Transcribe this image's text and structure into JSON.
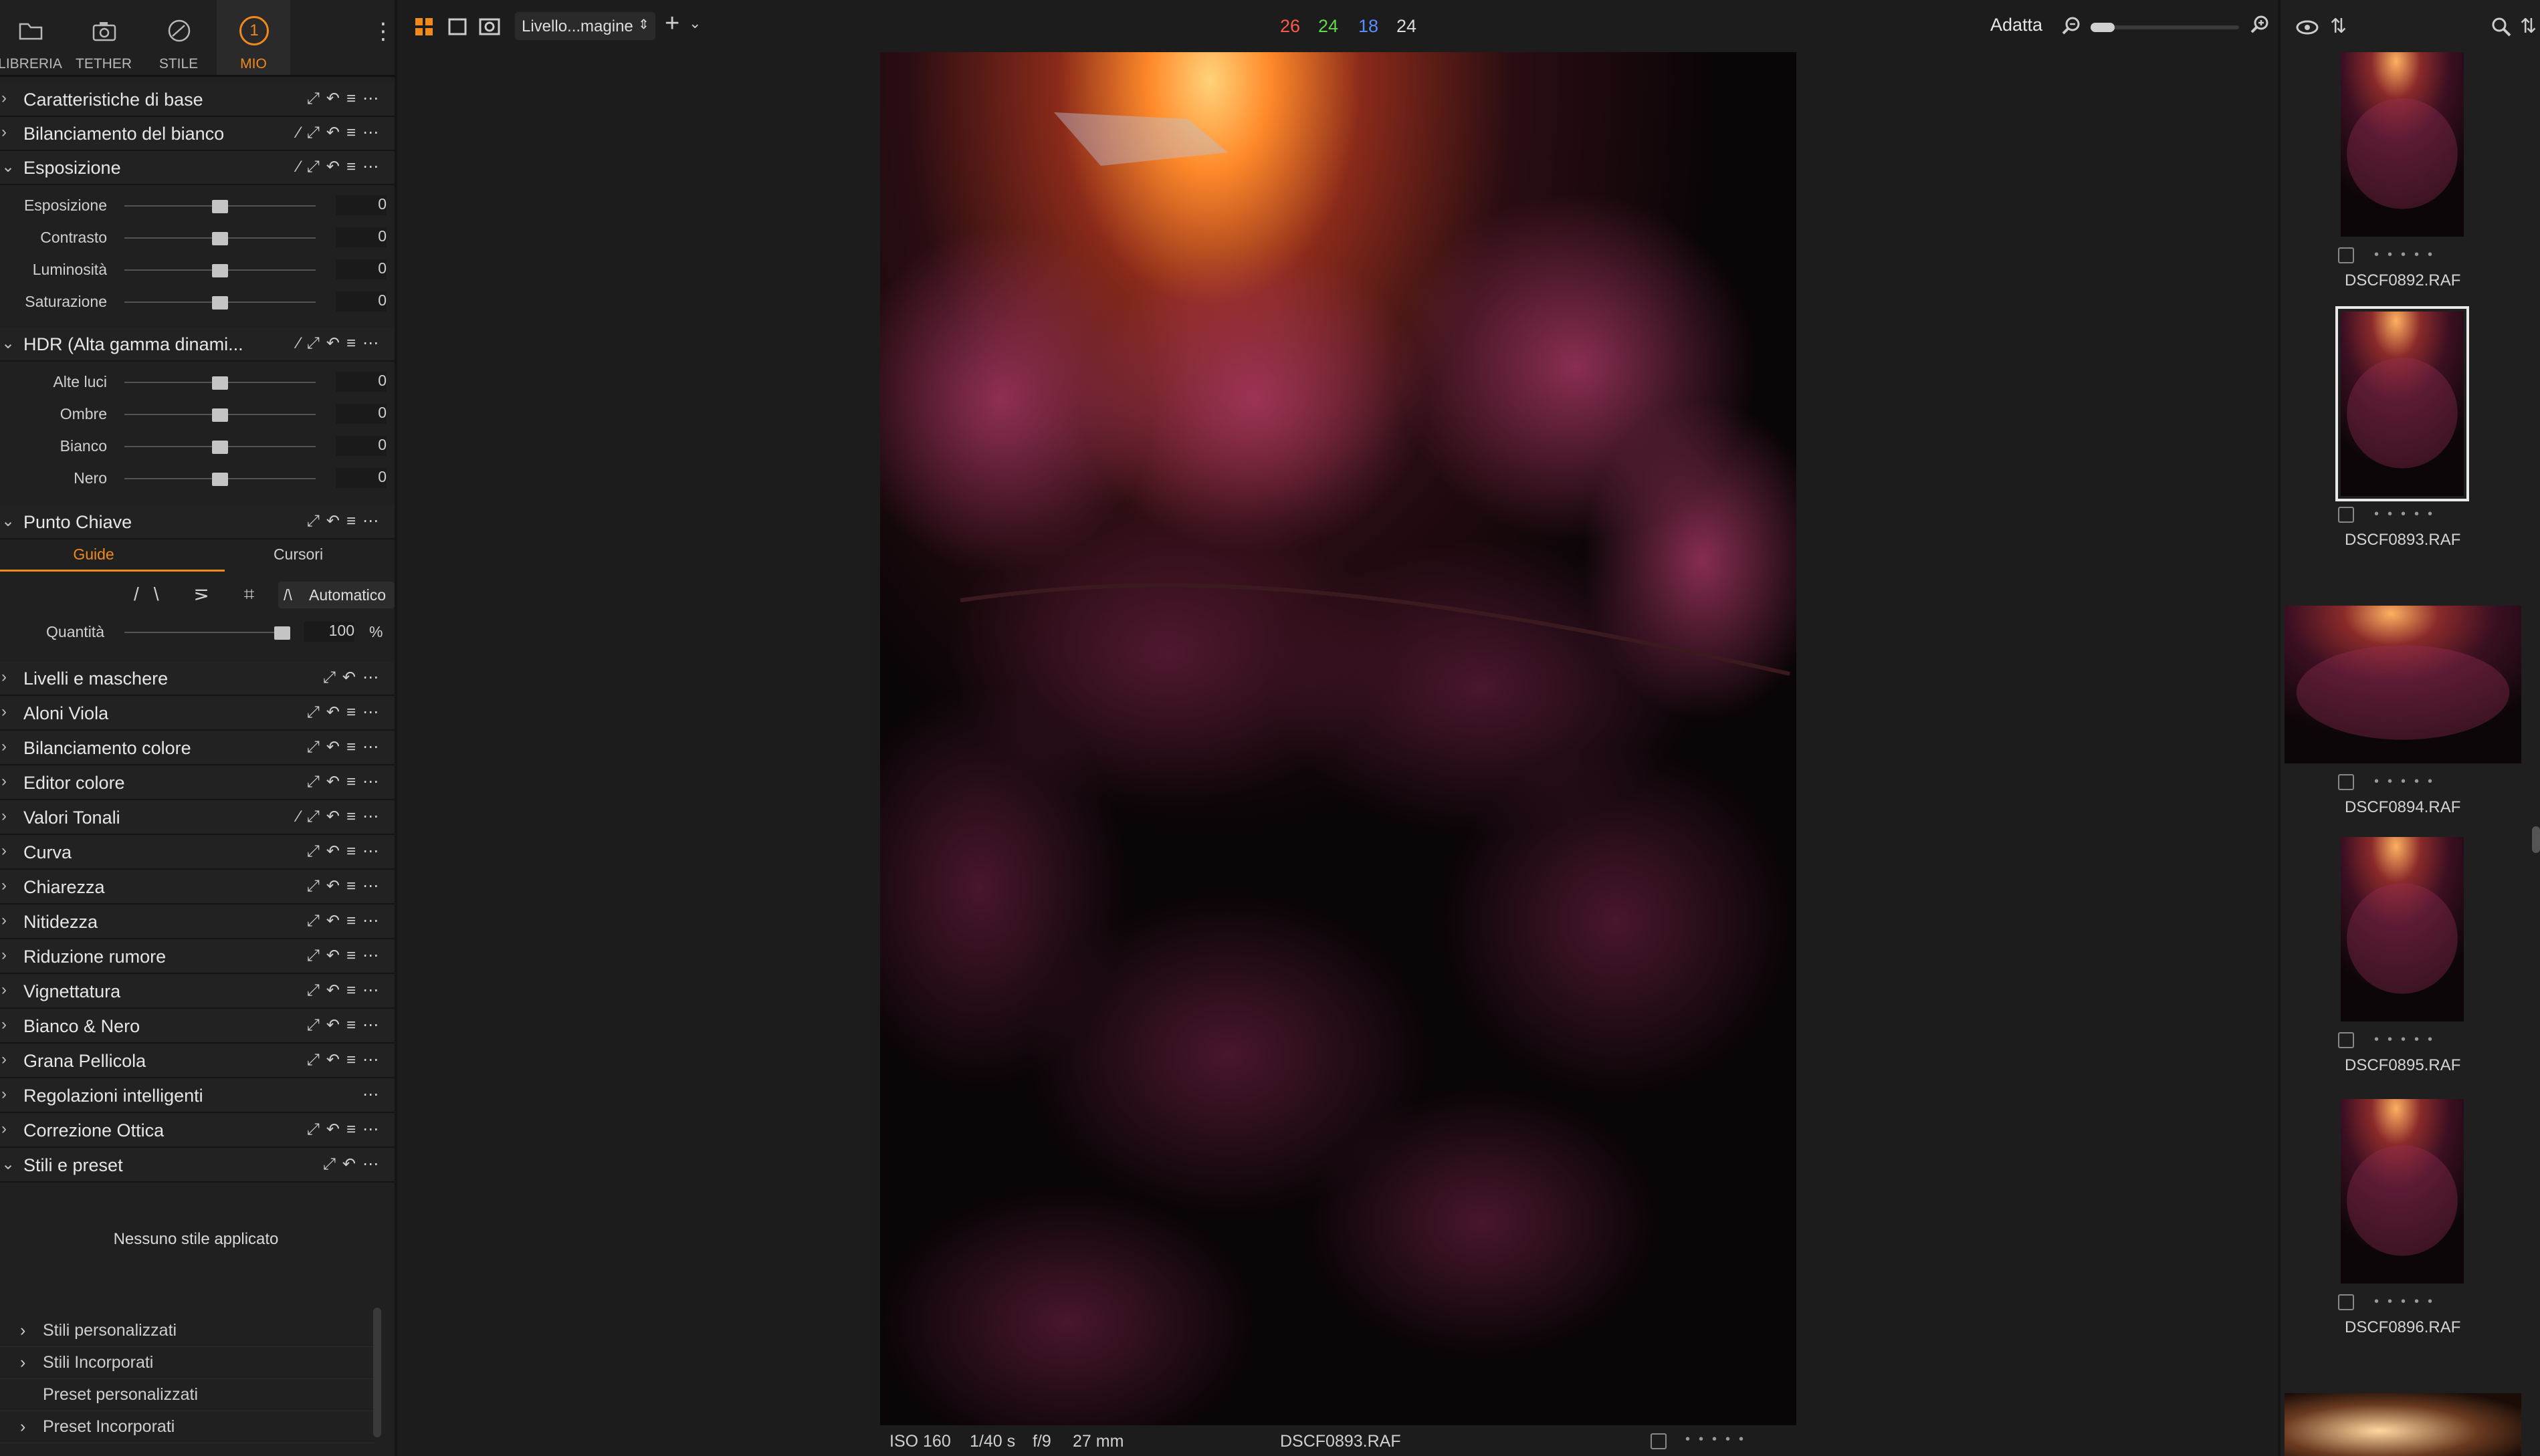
{
  "top_tabs": [
    {
      "label": "LIBRERIA",
      "icon": "folder-icon"
    },
    {
      "label": "TETHER",
      "icon": "camera-icon"
    },
    {
      "label": "STILE",
      "icon": "style-icon"
    },
    {
      "label": "MIO",
      "icon": "user-tool-icon",
      "badge": "1"
    }
  ],
  "panel": {
    "caratteristiche": "Caratteristiche di base",
    "bilanciamento_bianco": "Bilanciamento del bianco",
    "esposizione": {
      "title": "Esposizione",
      "sliders": [
        {
          "label": "Esposizione",
          "value": "0",
          "level": 0.5
        },
        {
          "label": "Contrasto",
          "value": "0",
          "level": 0.5
        },
        {
          "label": "Luminosità",
          "value": "0",
          "level": 0.5
        },
        {
          "label": "Saturazione",
          "value": "0",
          "level": 0.5
        }
      ]
    },
    "hdr": {
      "title": "HDR (Alta gamma dinami...",
      "sliders": [
        {
          "label": "Alte luci",
          "value": "0",
          "level": 0.5
        },
        {
          "label": "Ombre",
          "value": "0",
          "level": 0.5
        },
        {
          "label": "Bianco",
          "value": "0",
          "level": 0.5
        },
        {
          "label": "Nero",
          "value": "0",
          "level": 0.5
        }
      ]
    },
    "punto_chiave": {
      "title": "Punto Chiave",
      "tabs": [
        "Guide",
        "Cursori"
      ],
      "auto_label": "Automatico",
      "quantity_label": "Quantità",
      "quantity_value": "100",
      "quantity_unit": "%",
      "quantity_level": 1.0
    },
    "sections": [
      "Livelli e maschere",
      "Aloni Viola",
      "Bilanciamento colore",
      "Editor colore",
      "Valori Tonali",
      "Curva",
      "Chiarezza",
      "Nitidezza",
      "Riduzione rumore",
      "Vignettatura",
      "Bianco & Nero",
      "Grana Pellicola",
      "Regolazioni intelligenti",
      "Correzione Ottica",
      "Stili e preset"
    ],
    "styles_empty": "Nessuno stile applicato",
    "style_tree": [
      {
        "label": "Stili personalizzati",
        "expandable": true
      },
      {
        "label": "Stili Incorporati",
        "expandable": true
      },
      {
        "label": "Preset personalizzati",
        "expandable": false
      },
      {
        "label": "Preset Incorporati",
        "expandable": true
      }
    ]
  },
  "toolbar": {
    "layer_select": "Livello...magine",
    "count_red": "26",
    "count_green": "24",
    "count_blue": "18",
    "count_white": "24",
    "zoom_label": "Adatta",
    "colors": {
      "red": "#ff5a4a",
      "green": "#63d84d",
      "blue": "#5a8cff",
      "accent": "#f08a1c"
    }
  },
  "viewer": {
    "iso": "ISO 160",
    "shutter": "1/40 s",
    "aperture": "f/9",
    "focal": "27 mm",
    "filename": "DSCF0893.RAF"
  },
  "filmstrip": [
    {
      "name": "DSCF0892.RAF"
    },
    {
      "name": "DSCF0893.RAF",
      "selected": true
    },
    {
      "name": "DSCF0894.RAF"
    },
    {
      "name": "DSCF0895.RAF"
    },
    {
      "name": "DSCF0896.RAF"
    }
  ]
}
